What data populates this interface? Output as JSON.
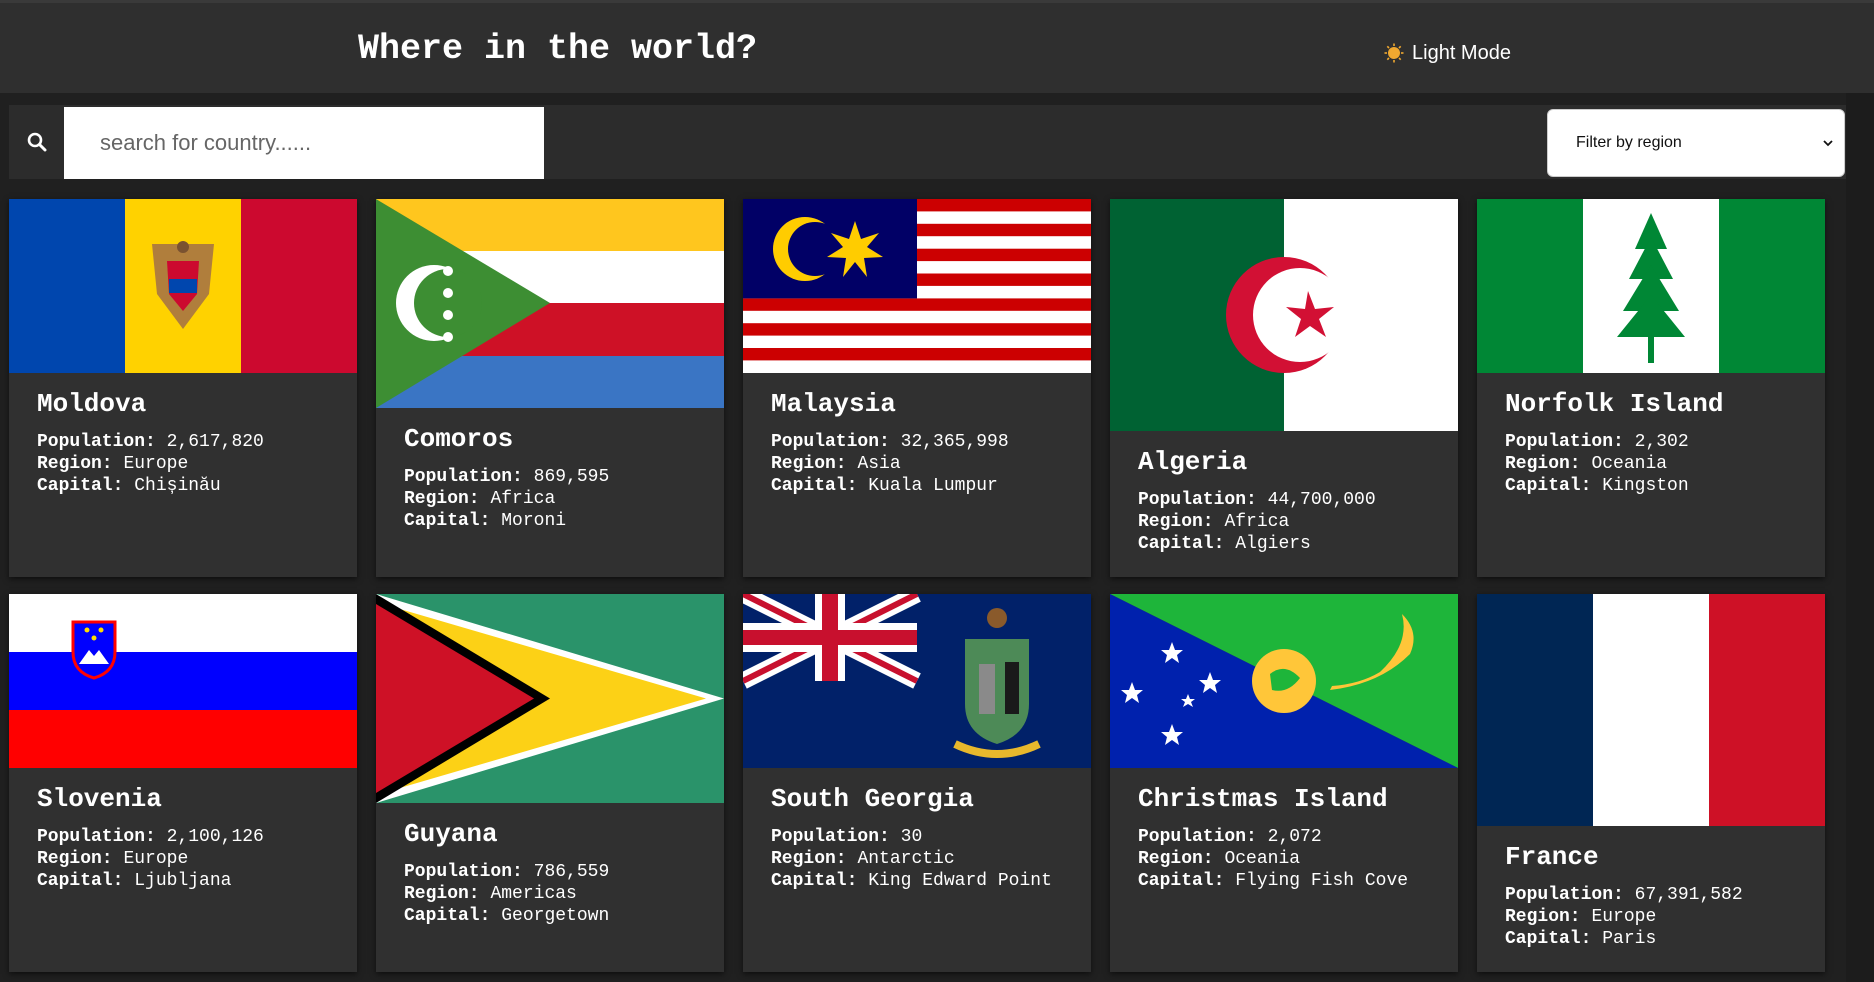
{
  "header": {
    "title": "Where in the world?",
    "mode_toggle_label": "Light Mode",
    "mode_icon": "sun-icon"
  },
  "search": {
    "placeholder": "search for country......",
    "value": "",
    "icon": "search-icon"
  },
  "filter": {
    "selected": "Filter by region",
    "icon": "chevron-down-icon"
  },
  "labels": {
    "population": "Population:",
    "region": "Region:",
    "capital": "Capital:"
  },
  "colors": {
    "background": "#202020",
    "header": "#2f2f2f",
    "card": "#303030",
    "text": "#ffffff"
  },
  "countries": [
    {
      "name": "Moldova",
      "population": "2,617,820",
      "region": "Europe",
      "capital": "Chișinău",
      "flag": "moldova-flag"
    },
    {
      "name": "Comoros",
      "population": "869,595",
      "region": "Africa",
      "capital": "Moroni",
      "flag": "comoros-flag"
    },
    {
      "name": "Malaysia",
      "population": "32,365,998",
      "region": "Asia",
      "capital": "Kuala Lumpur",
      "flag": "malaysia-flag"
    },
    {
      "name": "Algeria",
      "population": "44,700,000",
      "region": "Africa",
      "capital": "Algiers",
      "flag": "algeria-flag"
    },
    {
      "name": "Norfolk Island",
      "population": "2,302",
      "region": "Oceania",
      "capital": "Kingston",
      "flag": "norfolk-island-flag"
    },
    {
      "name": "Slovenia",
      "population": "2,100,126",
      "region": "Europe",
      "capital": "Ljubljana",
      "flag": "slovenia-flag"
    },
    {
      "name": "Guyana",
      "population": "786,559",
      "region": "Americas",
      "capital": "Georgetown",
      "flag": "guyana-flag"
    },
    {
      "name": "South Georgia",
      "population": "30",
      "region": "Antarctic",
      "capital": "King Edward Point",
      "flag": "south-georgia-flag"
    },
    {
      "name": "Christmas Island",
      "population": "2,072",
      "region": "Oceania",
      "capital": "Flying Fish Cove",
      "flag": "christmas-island-flag"
    },
    {
      "name": "France",
      "population": "67,391,582",
      "region": "Europe",
      "capital": "Paris",
      "flag": "france-flag"
    }
  ]
}
